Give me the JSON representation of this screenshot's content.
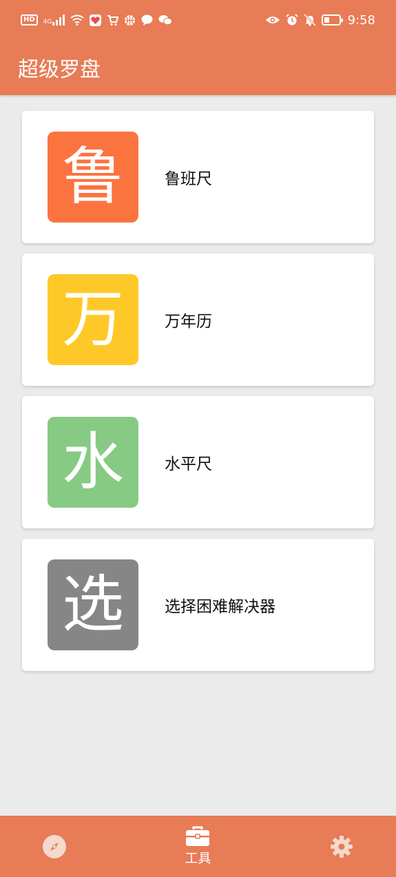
{
  "status_bar": {
    "left_icons": [
      "hd-icon",
      "4g-signal-icon",
      "wifi-icon",
      "health-app-icon",
      "cart-app-icon",
      "basketball-app-icon",
      "chat-bubble-icon",
      "wechat-icon"
    ],
    "hd_text": "HD",
    "network_text": "4G",
    "right_icons": [
      "eye-icon",
      "alarm-icon",
      "mute-bell-icon",
      "battery-icon"
    ],
    "battery_level": 0.35,
    "time": "9:58"
  },
  "app_bar": {
    "title": "超级罗盘"
  },
  "tools": [
    {
      "glyph": "鲁",
      "label": "鲁班尺",
      "color": "#fb7440"
    },
    {
      "glyph": "万",
      "label": "万年历",
      "color": "#fec928"
    },
    {
      "glyph": "水",
      "label": "水平尺",
      "color": "#87ca84"
    },
    {
      "glyph": "选",
      "label": "选择困难解决器",
      "color": "#868686"
    }
  ],
  "bottom_nav": {
    "items": [
      {
        "icon": "compass-icon",
        "label": ""
      },
      {
        "icon": "toolbox-icon",
        "label": "工具",
        "active": true
      },
      {
        "icon": "gear-icon",
        "label": ""
      }
    ]
  },
  "colors": {
    "accent": "#e77c56",
    "background": "#ebebeb"
  }
}
